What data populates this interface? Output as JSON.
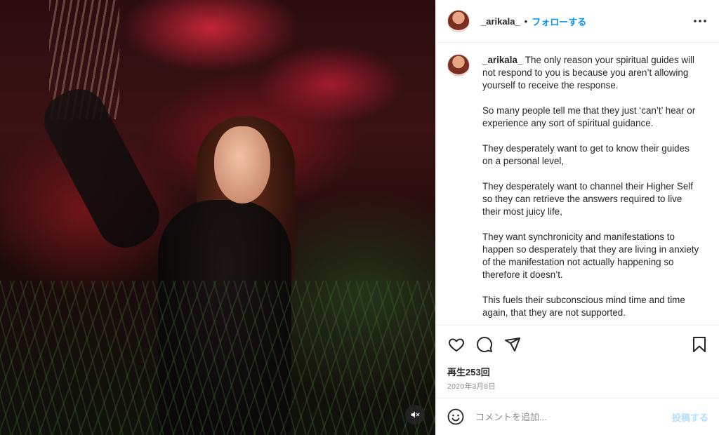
{
  "post": {
    "username": "_arikala_",
    "follow_label": "フォローする",
    "separator": "•",
    "caption_user": "_arikala_",
    "caption_paragraphs": [
      "The only reason your spiritual guides will not respond to you is because you aren’t allowing yourself to receive the response.",
      "So many people tell me that they just ‘can’t’ hear or experience any sort of spiritual guidance.",
      "They desperately want to get to know their guides on a personal level,",
      "They desperately want to channel their Higher Self so they can retrieve the answers required to live their most juicy life,",
      "They want synchronicity and manifestations to happen so desperately that they are living in anxiety of the manifestation not actually happening so therefore it doesn’t.",
      "This fuels their subconscious mind time and time again, that they are not supported."
    ],
    "views": "再生253回",
    "date": "2020年3月8日"
  },
  "comment": {
    "placeholder": "コメントを追加...",
    "post_label": "投稿する"
  },
  "icons": {
    "more": "more-options-icon",
    "like": "heart-icon",
    "comment": "comment-icon",
    "share": "send-icon",
    "save": "bookmark-icon",
    "emoji": "emoji-icon",
    "mute": "muted-speaker-icon"
  },
  "colors": {
    "accent": "#0095f6",
    "post_disabled": "#b2dffc",
    "muted_text": "#8e8e8e"
  }
}
